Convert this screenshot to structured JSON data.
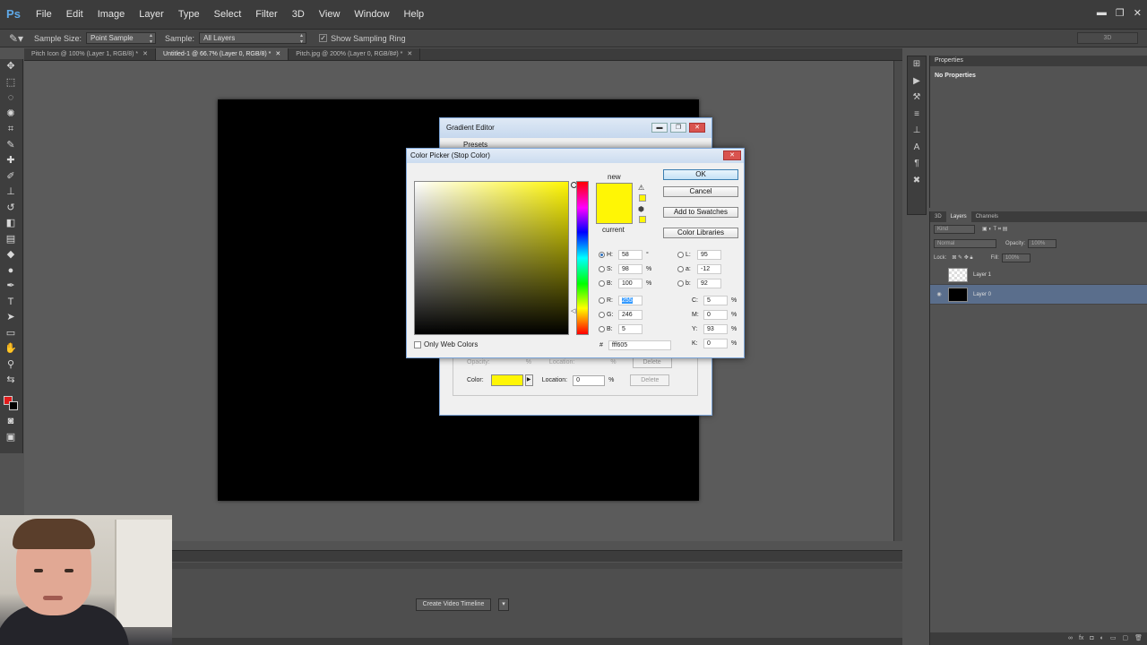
{
  "app": {
    "logo": "Ps"
  },
  "menu": [
    "File",
    "Edit",
    "Image",
    "Layer",
    "Type",
    "Select",
    "Filter",
    "3D",
    "View",
    "Window",
    "Help"
  ],
  "window_controls": [
    "▬",
    "❐",
    "✕"
  ],
  "options": {
    "sample_size_label": "Sample Size:",
    "sample_size_value": "Point Sample",
    "sample_label": "Sample:",
    "sample_value": "All Layers",
    "show_ring_label": "Show Sampling Ring",
    "workspace": "3D"
  },
  "tabs": [
    {
      "label": "Pitch Icon @ 100% (Layer 1, RGB/8) *",
      "close": "✕"
    },
    {
      "label": "Untitled-1 @ 66.7% (Layer 0, RGB/8) *",
      "close": "✕"
    },
    {
      "label": "Pitch.jpg @ 200% (Layer 0, RGB/8#) *",
      "close": "✕"
    }
  ],
  "timeline": {
    "create_button": "Create Video Timeline",
    "dropdown": "▾"
  },
  "properties": {
    "title": "Properties",
    "subtitle": "No Properties"
  },
  "layers_panel": {
    "tabs": [
      "3D",
      "Layers",
      "Channels"
    ],
    "kind": "Kind",
    "blend_mode": "Normal",
    "opacity_label": "Opacity:",
    "opacity_value": "100%",
    "lock_label": "Lock:",
    "fill_label": "Fill:",
    "fill_value": "100%",
    "layers": [
      {
        "name": "Layer 1",
        "visible": false
      },
      {
        "name": "Layer 0",
        "visible": true,
        "selected": true
      }
    ]
  },
  "gradient_editor": {
    "title": "Gradient Editor",
    "presets_label": "Presets",
    "opacity_label": "Opacity:",
    "location_label": "Location:",
    "percent": "%",
    "delete_label": "Delete",
    "color_label": "Color:",
    "color_location_label": "Location:",
    "color_location_value": "0",
    "color_swatch": "#fff605"
  },
  "color_picker": {
    "title": "Color Picker (Stop Color)",
    "new_label": "new",
    "current_label": "current",
    "ok_label": "OK",
    "cancel_label": "Cancel",
    "add_swatches_label": "Add to Swatches",
    "color_libraries_label": "Color Libraries",
    "only_web_colors_label": "Only Web Colors",
    "hsb": {
      "h": "58",
      "h_unit": "°",
      "s": "98",
      "s_unit": "%",
      "b": "100",
      "b_unit": "%"
    },
    "rgb": {
      "r": "255",
      "g": "246",
      "b": "5"
    },
    "lab": {
      "l": "95",
      "a": "-12",
      "b": "92"
    },
    "cmyk": {
      "c": "5",
      "m": "0",
      "y": "93",
      "k": "0",
      "unit": "%"
    },
    "hex_label": "#",
    "hex": "fff605",
    "selected_color": "#fff605"
  },
  "colors": {
    "foreground": "#e21b1b",
    "background": "#000000",
    "accent": "#5fa9e8"
  }
}
